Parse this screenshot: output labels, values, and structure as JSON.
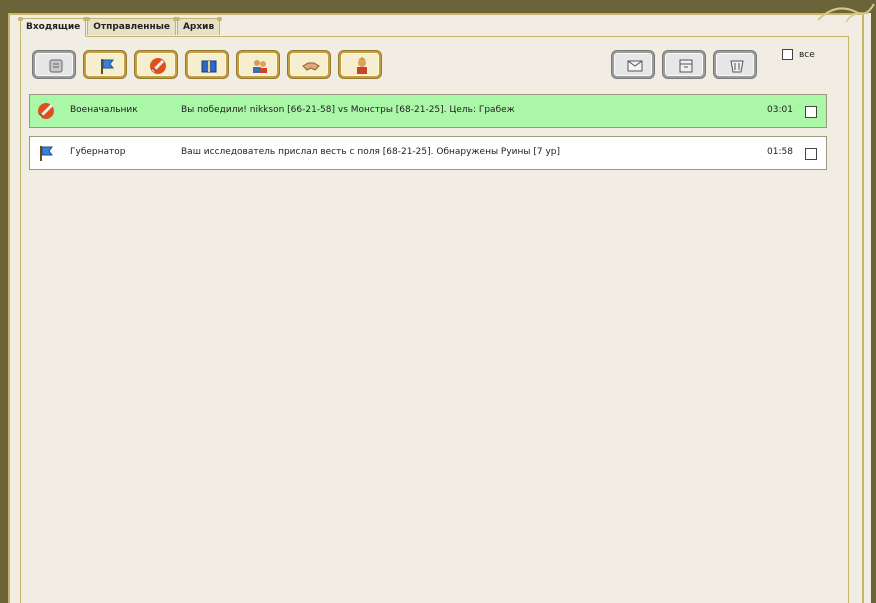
{
  "tabs": [
    {
      "label": "Входящие",
      "active": true
    },
    {
      "label": "Отправленные",
      "active": false
    },
    {
      "label": "Архив",
      "active": false
    }
  ],
  "filter_buttons": [
    {
      "icon": "scroll-icon",
      "style": "gray"
    },
    {
      "icon": "governor-flag-icon",
      "style": "gold"
    },
    {
      "icon": "sword-icon",
      "style": "gold"
    },
    {
      "icon": "book-icon",
      "style": "gold"
    },
    {
      "icon": "people-icon",
      "style": "gold"
    },
    {
      "icon": "handshake-icon",
      "style": "gold"
    },
    {
      "icon": "leader-icon",
      "style": "gold"
    }
  ],
  "action_buttons": [
    {
      "icon": "envelope-icon"
    },
    {
      "icon": "archive-icon"
    },
    {
      "icon": "trash-basket-icon"
    }
  ],
  "select_all": {
    "label": "все",
    "checked": false
  },
  "messages": [
    {
      "icon": "sword-icon",
      "sender": "Военачальник",
      "subject": "Вы победили! nikkson [66-21-58] vs Монстры [68-21-25]. Цель: Грабеж",
      "time": "03:01",
      "unread": true,
      "highlight_color": "#aaf7a8"
    },
    {
      "icon": "governor-flag-icon",
      "sender": "Губернатор",
      "subject": "Ваш исследователь прислал весть с поля [68-21-25]. Обнаружены Руины [7 ур]",
      "time": "01:58",
      "unread": false
    }
  ]
}
